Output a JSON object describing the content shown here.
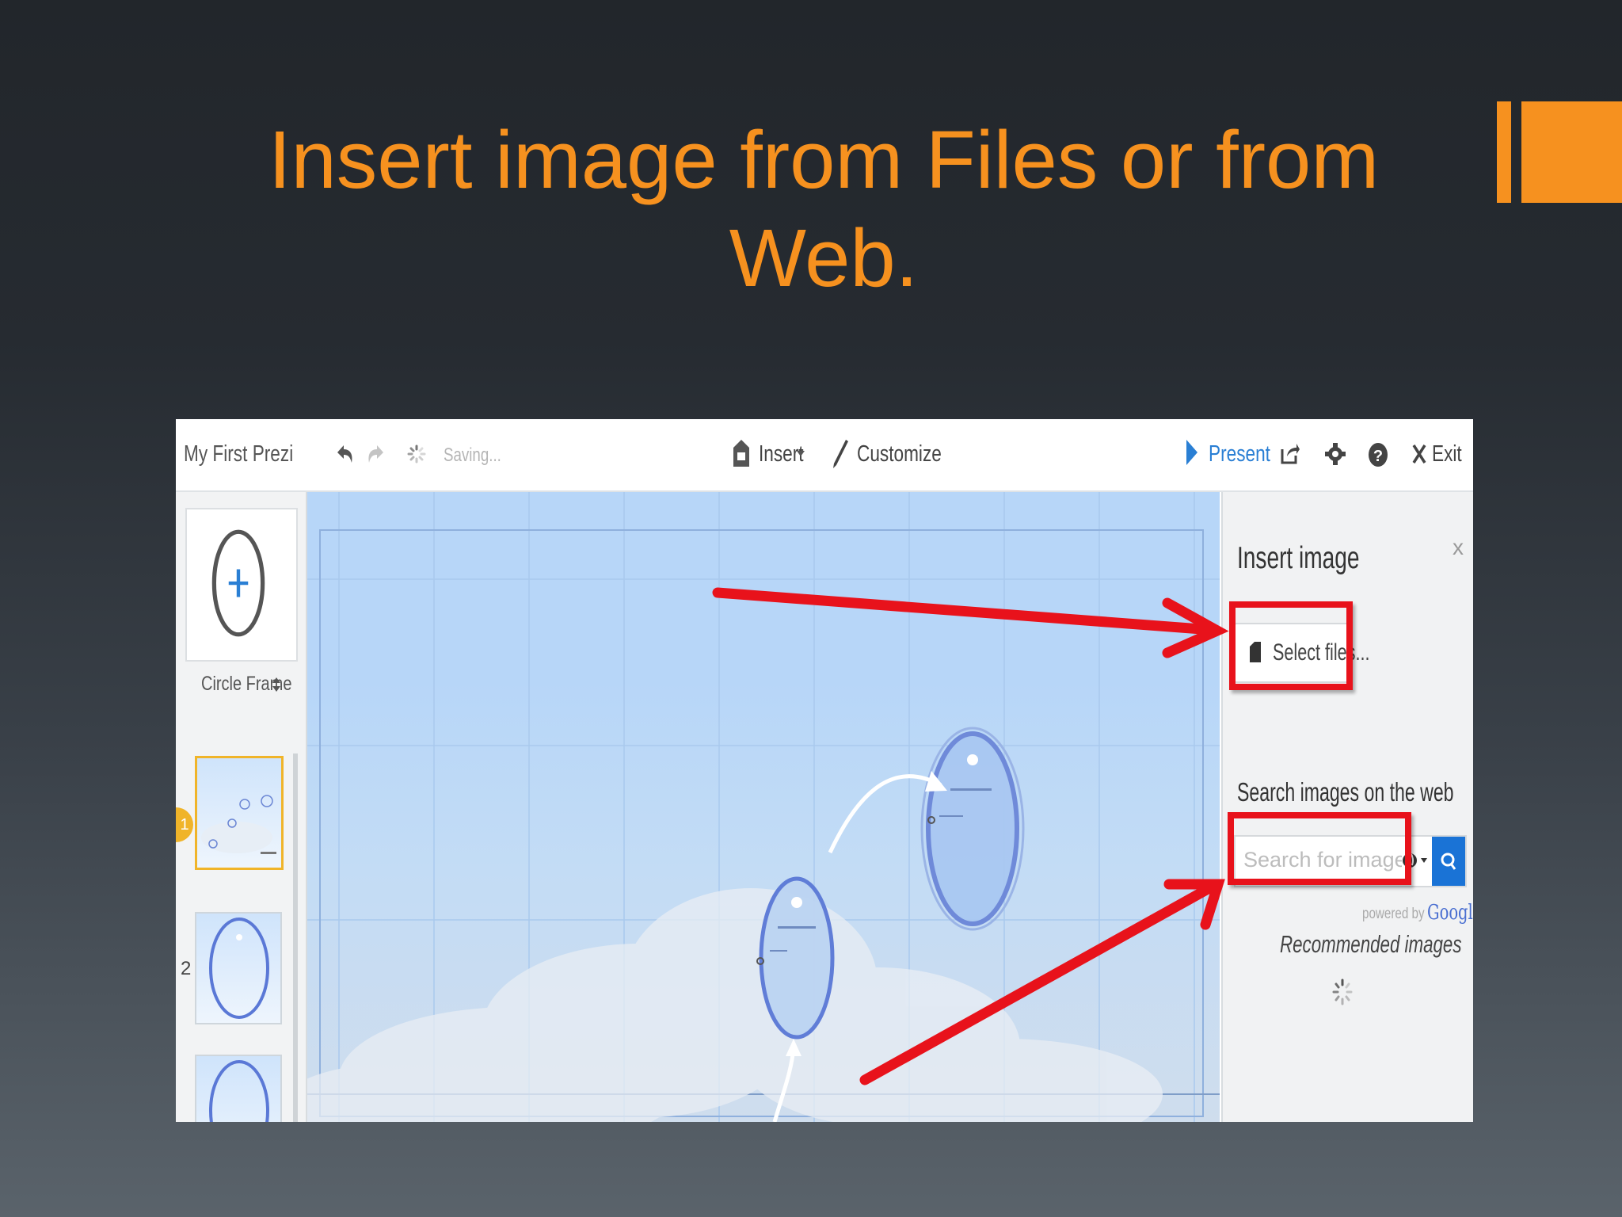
{
  "slide": {
    "title": "Insert image from Files or from Web.",
    "accent_color": "#f6911f"
  },
  "toolbar": {
    "app_title": "My First Prezi",
    "undo_icon": "undo-icon",
    "redo_icon": "redo-icon",
    "saving_label": "Saving...",
    "insert_label": "Insert",
    "customize_label": "Customize",
    "present_label": "Present",
    "exit_label": "Exit"
  },
  "left_panel": {
    "frame_type_label": "Circle Frame",
    "thumbnails": [
      {
        "number": "1"
      },
      {
        "number": "2"
      }
    ]
  },
  "insert_panel": {
    "title": "Insert image",
    "close_label": "x",
    "select_files_label": "Select files...",
    "search_heading": "Search images on the web",
    "search_placeholder": "Search for images...",
    "powered_by": "powered by",
    "powered_brand": "Google",
    "recommended_label": "Recommended images"
  },
  "annotations": {
    "highlight_color": "#e8121b"
  }
}
